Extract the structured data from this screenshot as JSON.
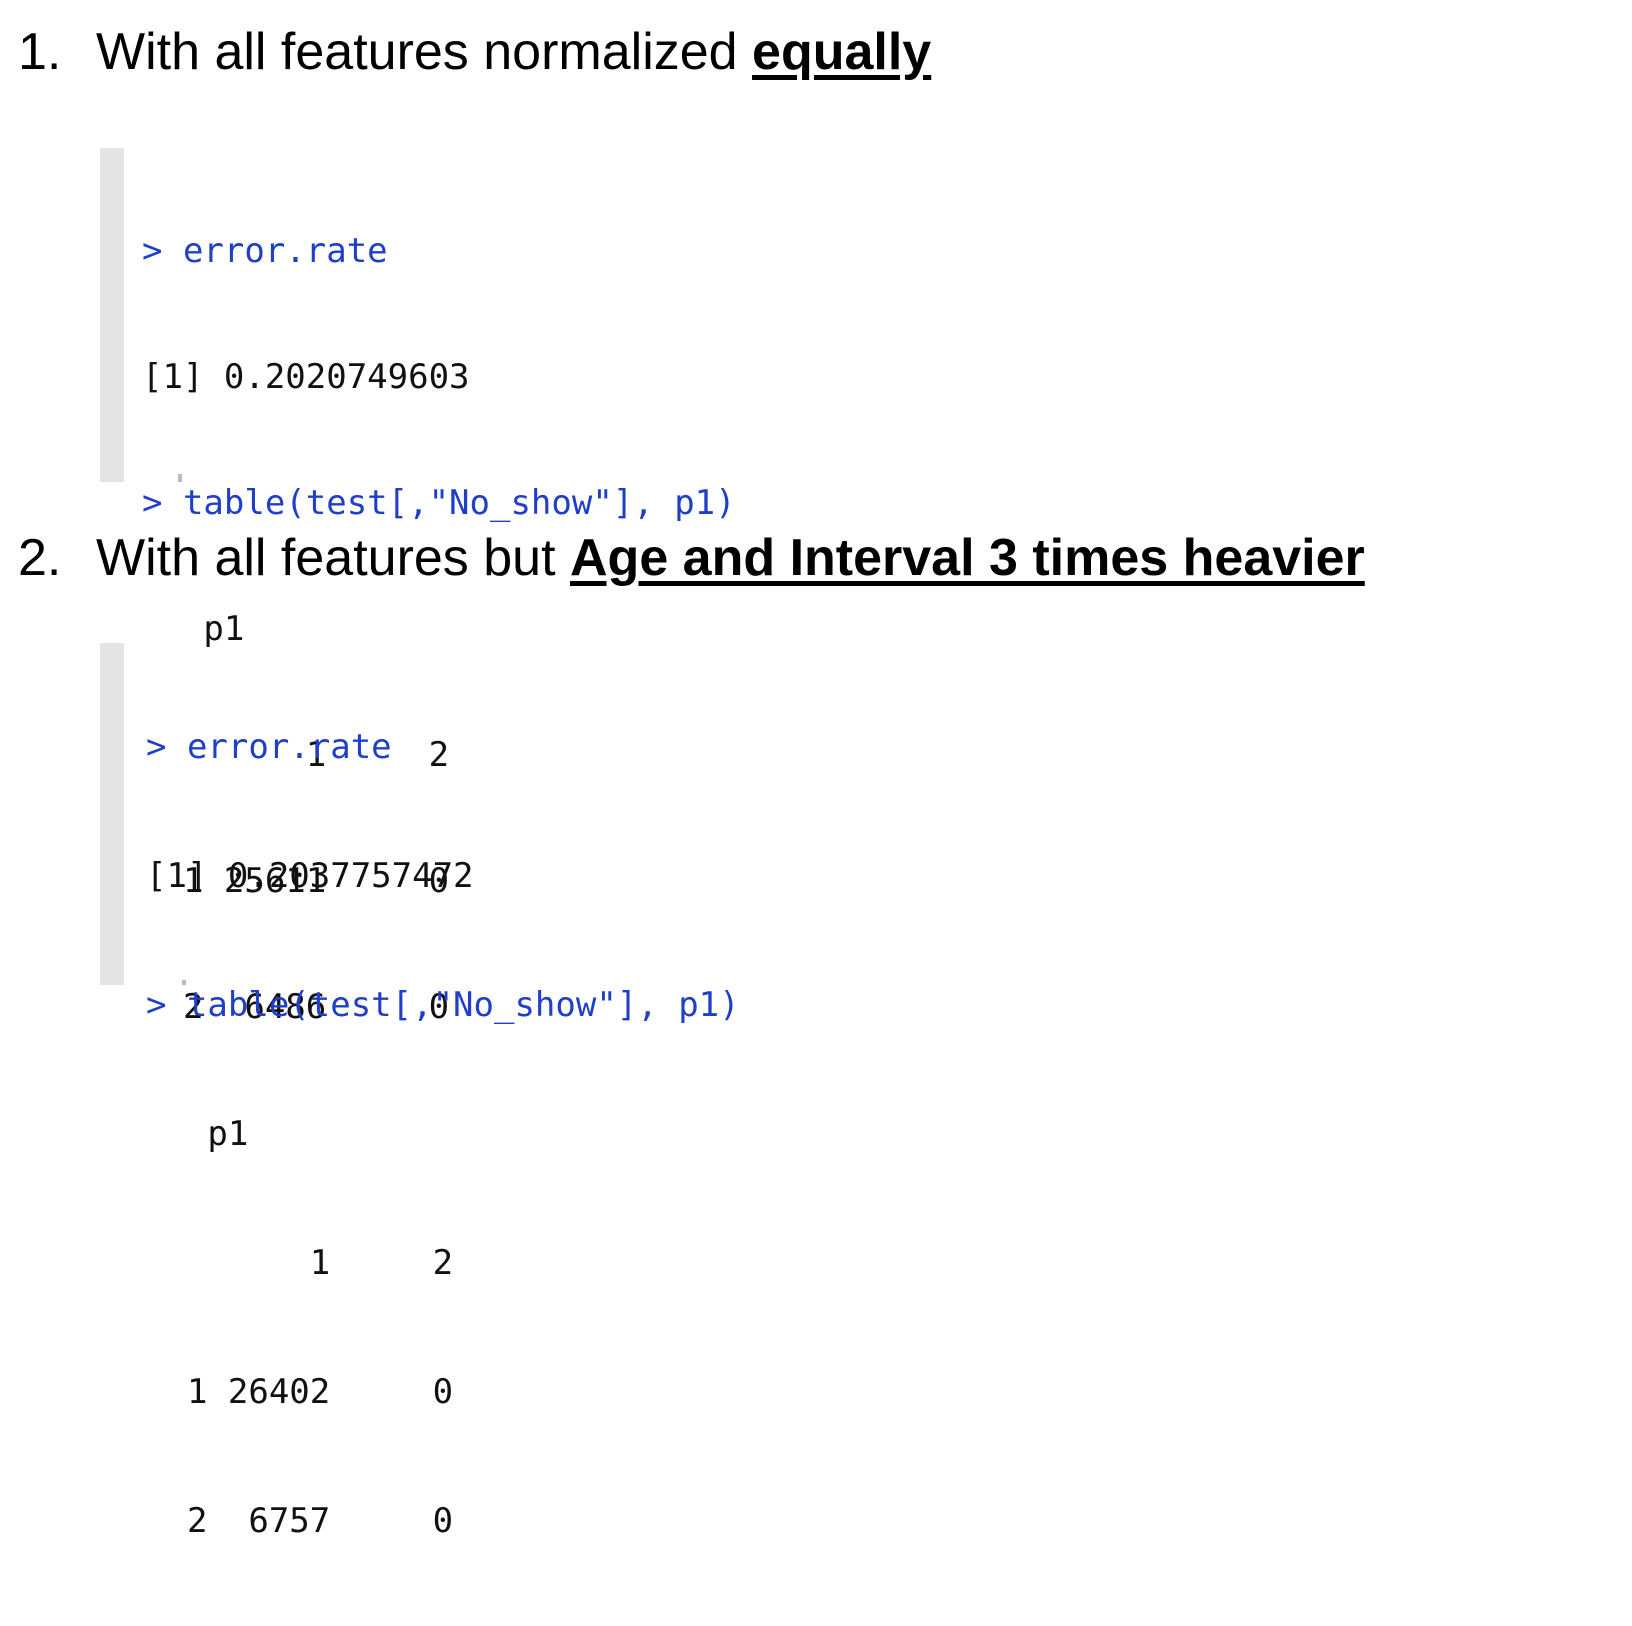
{
  "section1": {
    "number": "1.",
    "text": "With all features normalized ",
    "emphasis": "equally",
    "console": {
      "lines": [
        {
          "text": "> error.rate",
          "kind": "cmd"
        },
        {
          "text": "[1] 0.2020749603",
          "kind": "out"
        },
        {
          "text": "> table(test[,\"No_show\"], p1)",
          "kind": "cmd"
        },
        {
          "text": "   p1",
          "kind": "out"
        },
        {
          "text": "        1     2",
          "kind": "out"
        },
        {
          "text": "  1 25611     0",
          "kind": "out"
        },
        {
          "text": "  2  6486     0",
          "kind": "out"
        }
      ]
    }
  },
  "section2": {
    "number": "2.",
    "text": "With all features but ",
    "emphasis": "Age and Interval 3 times heavier",
    "console": {
      "lines": [
        {
          "text": "> error.rate",
          "kind": "cmd"
        },
        {
          "text": "[1] 0.2037757472",
          "kind": "out"
        },
        {
          "text": "> table(test[,\"No_show\"], p1)",
          "kind": "cmd"
        },
        {
          "text": "   p1",
          "kind": "out"
        },
        {
          "text": "        1     2",
          "kind": "out"
        },
        {
          "text": "  1 26402     0",
          "kind": "out"
        },
        {
          "text": "  2  6757     0",
          "kind": "out"
        }
      ]
    }
  },
  "colors": {
    "command": "#1f3fc9",
    "output": "#111111",
    "gutter": "#e4e4e4"
  }
}
